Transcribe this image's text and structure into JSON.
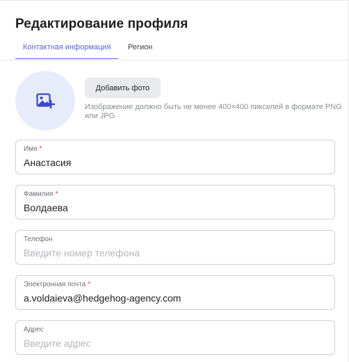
{
  "header": {
    "title": "Редактирование профиля"
  },
  "tabs": [
    {
      "label": "Контактная информация",
      "active": true
    },
    {
      "label": "Регион",
      "active": false
    }
  ],
  "photo": {
    "avatar_icon": "add-image-icon",
    "add_button_label": "Добавить фото",
    "hint": "Изображение должно быть не менее 400×400 пикселей в формате PNG или JPG"
  },
  "form": {
    "first_name": {
      "label": "Имя",
      "required": "*",
      "value": "Анастасия"
    },
    "last_name": {
      "label": "Фамилия",
      "required": "*",
      "value": "Волдаева"
    },
    "phone": {
      "label": "Телефон",
      "placeholder": "Введите номер телефона"
    },
    "email": {
      "label": "Электронная почта",
      "required": "*",
      "value": "a.voldaieva@hedgehog-agency.com"
    },
    "address": {
      "label": "Адрес",
      "placeholder": "Введите адрес"
    }
  },
  "colors": {
    "accent": "#5a63d8",
    "required": "#e0334a",
    "avatar_bg": "#e7ecfb"
  }
}
